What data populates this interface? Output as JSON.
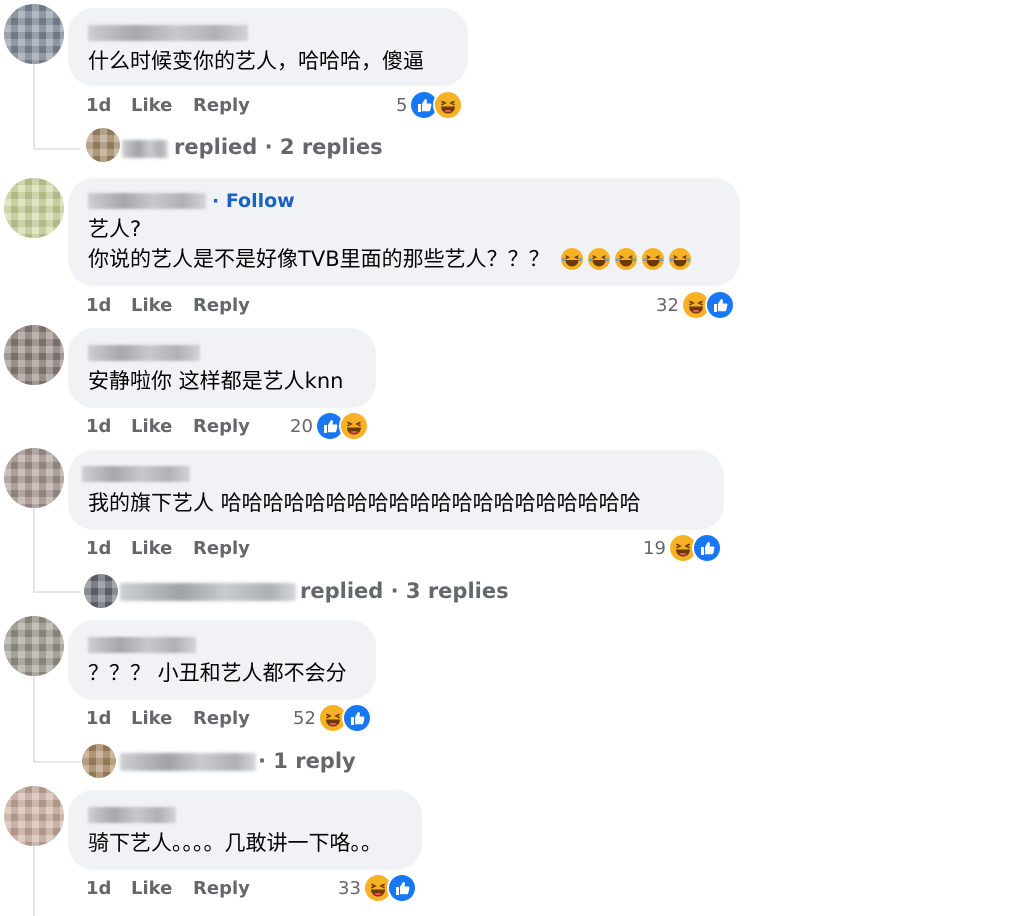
{
  "colors": {
    "bubble": "#f0f2f5",
    "meta_text": "#65676b",
    "link_blue": "#1a61c6",
    "like_blue": "#1877f2",
    "haha_yellow": "#f7b125"
  },
  "actions": {
    "like": "Like",
    "reply": "Reply"
  },
  "comments": [
    {
      "text_lines": [
        "什么时候变你的艺人，哈哈哈，傻逼"
      ],
      "time": "1d",
      "reaction_count": "5",
      "reactions": [
        "like-icon",
        "haha-icon"
      ],
      "replies_summary": "replied · 2 replies"
    },
    {
      "follow_label": "· Follow",
      "text_lines": [
        "艺人?",
        "你说的艺人是不是好像TVB里面的那些艺人？？？"
      ],
      "inline_emoji": [
        "laugh-cry-emoji",
        "laugh-cry-emoji",
        "laugh-cry-emoji",
        "laugh-cry-emoji",
        "laugh-cry-emoji"
      ],
      "time": "1d",
      "reaction_count": "32",
      "reactions": [
        "haha-icon",
        "like-icon"
      ]
    },
    {
      "text_lines": [
        "安静啦你 这样都是艺人knn"
      ],
      "time": "1d",
      "reaction_count": "20",
      "reactions": [
        "like-icon",
        "haha-icon"
      ]
    },
    {
      "text_lines": [
        "我的旗下艺人 哈哈哈哈哈哈哈哈哈哈哈哈哈哈哈哈哈哈哈哈"
      ],
      "time": "1d",
      "reaction_count": "19",
      "reactions": [
        "haha-icon",
        "like-icon"
      ],
      "replies_summary": "replied · 3 replies"
    },
    {
      "text_lines": [
        "？？？ 小丑和艺人都不会分"
      ],
      "time": "1d",
      "reaction_count": "52",
      "reactions": [
        "haha-icon",
        "like-icon"
      ],
      "replies_summary": "· 1 reply"
    },
    {
      "text_lines": [
        "骑下艺人。。。。几敢讲一下咯。。"
      ],
      "time": "1d",
      "reaction_count": "33",
      "reactions": [
        "haha-icon",
        "like-icon"
      ]
    }
  ]
}
